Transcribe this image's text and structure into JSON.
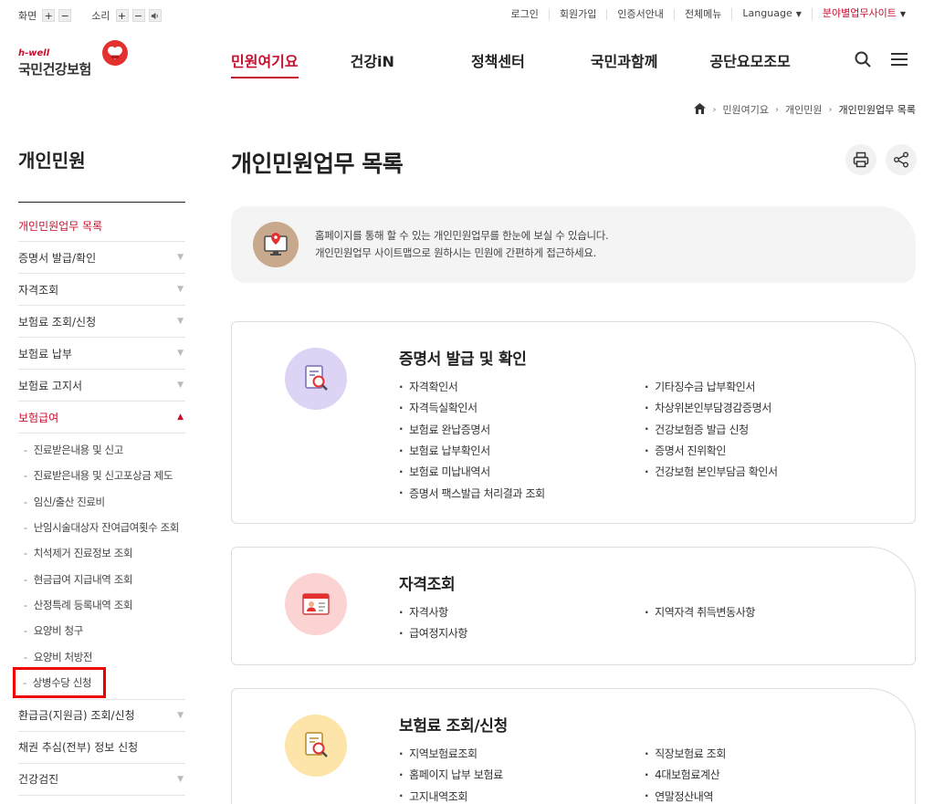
{
  "utility": {
    "screen_label": "화면",
    "sound_label": "소리",
    "plus": "+",
    "minus": "−",
    "links": [
      "로그인",
      "회원가입",
      "인증서안내",
      "전체메뉴"
    ],
    "language": "Language",
    "field_site": "분야별업무사이트"
  },
  "logo": {
    "tagline": "h-well",
    "name": "국민건강보험"
  },
  "gnb": [
    "민원여기요",
    "건강iN",
    "정책센터",
    "국민과함께",
    "공단요모조모"
  ],
  "breadcrumb": [
    "민원여기요",
    "개인민원",
    "개인민원업무 목록"
  ],
  "sidebar": {
    "title": "개인민원",
    "top_items": [
      {
        "label": "개인민원업무 목록",
        "active": true,
        "arrow": false
      },
      {
        "label": "증명서 발급/확인",
        "arrow": true
      },
      {
        "label": "자격조회",
        "arrow": true
      },
      {
        "label": "보험료 조회/신청",
        "arrow": true
      },
      {
        "label": "보험료 납부",
        "arrow": true
      },
      {
        "label": "보험료 고지서",
        "arrow": true
      },
      {
        "label": "보험급여",
        "active": true,
        "arrow": "up"
      }
    ],
    "sub_items": [
      "진료받은내용 및 신고",
      "진료받은내용 및 신고포상금 제도",
      "임신/출산 진료비",
      "난임시술대상자 잔여급여횟수 조회",
      "치석제거 진료정보 조회",
      "현금급여 지급내역 조회",
      "산정특례 등록내역 조회",
      "요양비 청구",
      "요양비 처방전",
      "상병수당 신청"
    ],
    "bottom_items": [
      {
        "label": "환급금(지원금) 조회/신청",
        "arrow": true
      },
      {
        "label": "채권 추심(전부) 정보 신청",
        "arrow": false
      },
      {
        "label": "건강검진",
        "arrow": true
      }
    ]
  },
  "main": {
    "title": "개인민원업무 목록",
    "notice": [
      "홈페이지를 통해 할 수 있는 개인민원업무를 한눈에 보실 수 있습니다.",
      "개인민원업무 사이트맵으로 원하시는 민원에 간편하게 접근하세요."
    ],
    "cards": [
      {
        "title": "증명서 발급 및 확인",
        "icon": "document-search-icon",
        "color": "#dcd3f5",
        "left": [
          "자격확인서",
          "자격득실확인서",
          "보험료 완납증명서",
          "보험료 납부확인서",
          "보험료 미납내역서",
          "증명서 팩스발급 처리결과 조회"
        ],
        "right": [
          "기타징수금 납부확인서",
          "차상위본인부담경감증명서",
          "건강보험증 발급 신청",
          "증명서 진위확인",
          "건강보험 본인부담금 확인서"
        ]
      },
      {
        "title": "자격조회",
        "icon": "id-card-icon",
        "color": "#fbd3d3",
        "left": [
          "자격사항",
          "급여정지사항"
        ],
        "right": [
          "지역자격 취득변동사항"
        ]
      },
      {
        "title": "보험료 조회/신청",
        "icon": "document-search-icon",
        "color": "#fde4a8",
        "left": [
          "지역보험료조회",
          "홈페이지 납부 보험료",
          "고지내역조회"
        ],
        "right": [
          "직장보험료 조회",
          "4대보험료계산",
          "연말정산내역"
        ]
      }
    ]
  },
  "colors": {
    "brand_red": "#c8102e",
    "heart_red": "#e4312f",
    "highlight_box": "#ee0000"
  }
}
